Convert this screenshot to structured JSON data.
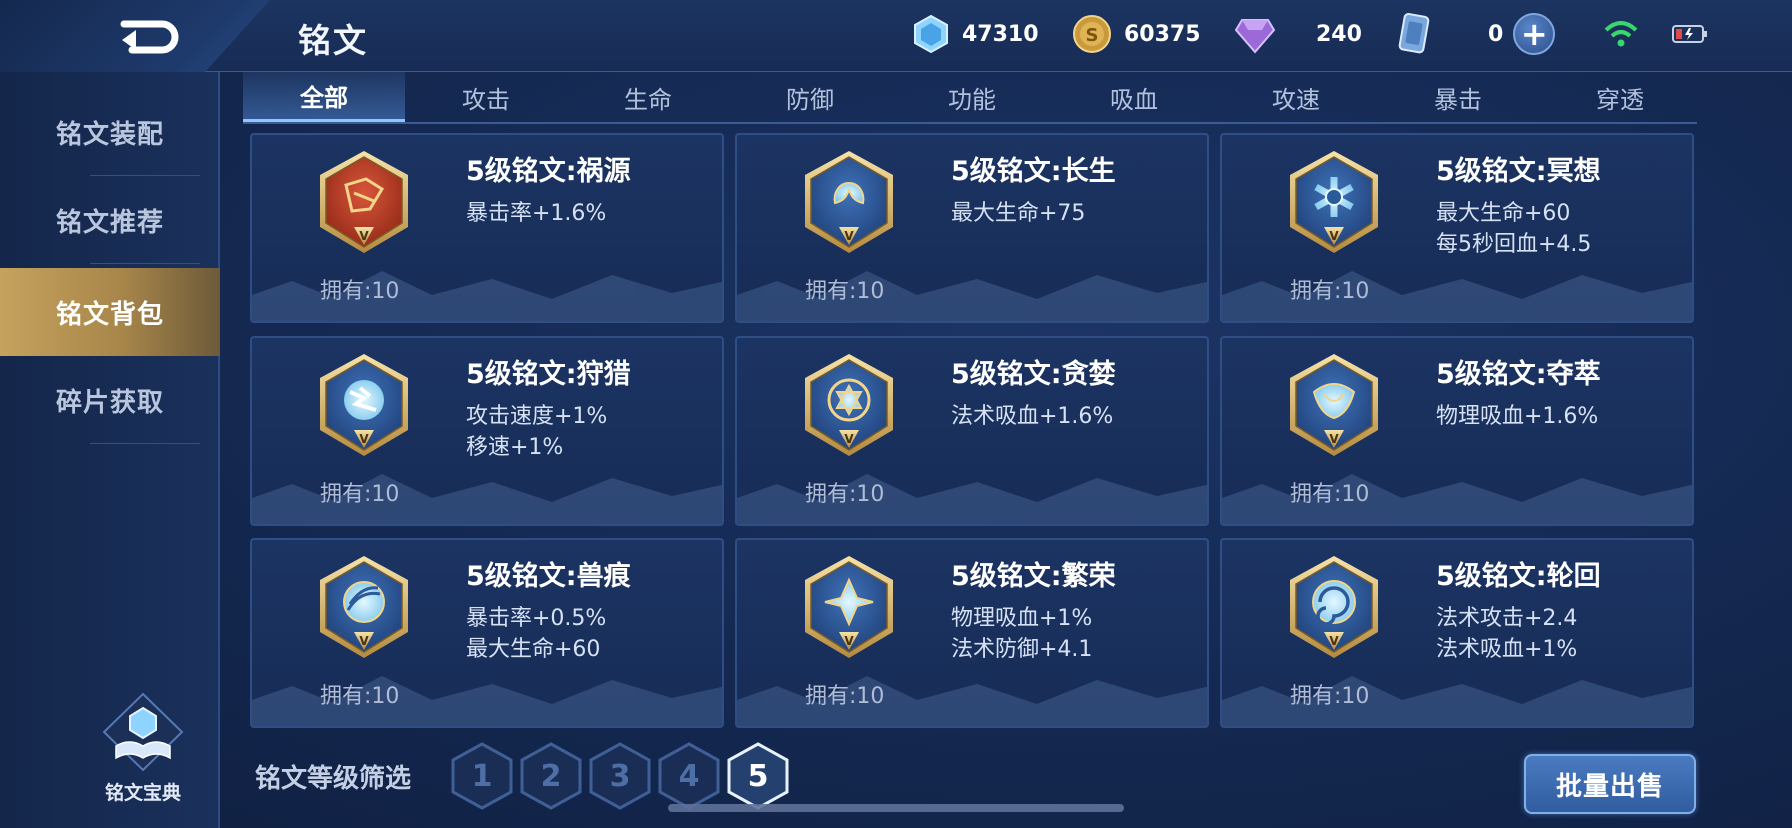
{
  "header": {
    "title": "铭文",
    "currencies": [
      {
        "name": "diamond-currency",
        "icon": "blue-crystal-icon",
        "value": "47310"
      },
      {
        "name": "gold-coin-currency",
        "icon": "gold-coin-icon",
        "value": "60375"
      },
      {
        "name": "gem-currency",
        "icon": "purple-gem-icon",
        "value": "240"
      },
      {
        "name": "card-currency",
        "icon": "card-icon",
        "value": "0"
      }
    ],
    "plus_label": "+"
  },
  "sidebar": {
    "items": [
      {
        "label": "铭文装配",
        "active": false
      },
      {
        "label": "铭文推荐",
        "active": false
      },
      {
        "label": "铭文背包",
        "active": true
      },
      {
        "label": "碎片获取",
        "active": false
      }
    ],
    "codex_label": "铭文宝典"
  },
  "tabs": [
    {
      "label": "全部",
      "active": true
    },
    {
      "label": "攻击",
      "active": false
    },
    {
      "label": "生命",
      "active": false
    },
    {
      "label": "防御",
      "active": false
    },
    {
      "label": "功能",
      "active": false
    },
    {
      "label": "吸血",
      "active": false
    },
    {
      "label": "攻速",
      "active": false
    },
    {
      "label": "暴击",
      "active": false
    },
    {
      "label": "穿透",
      "active": false
    }
  ],
  "cards": [
    {
      "name": "5级铭文:祸源",
      "stats": [
        "暴击率+1.6%"
      ],
      "owned": "拥有:10",
      "color": "red"
    },
    {
      "name": "5级铭文:长生",
      "stats": [
        "最大生命+75"
      ],
      "owned": "拥有:10",
      "color": "blue"
    },
    {
      "name": "5级铭文:冥想",
      "stats": [
        "最大生命+60",
        "每5秒回血+4.5"
      ],
      "owned": "拥有:10",
      "color": "blue"
    },
    {
      "name": "5级铭文:狩猎",
      "stats": [
        "攻击速度+1%",
        "移速+1%"
      ],
      "owned": "拥有:10",
      "color": "blue"
    },
    {
      "name": "5级铭文:贪婪",
      "stats": [
        "法术吸血+1.6%"
      ],
      "owned": "拥有:10",
      "color": "blue"
    },
    {
      "name": "5级铭文:夺萃",
      "stats": [
        "物理吸血+1.6%"
      ],
      "owned": "拥有:10",
      "color": "blue"
    },
    {
      "name": "5级铭文:兽痕",
      "stats": [
        "暴击率+0.5%",
        "最大生命+60"
      ],
      "owned": "拥有:10",
      "color": "blue"
    },
    {
      "name": "5级铭文:繁荣",
      "stats": [
        "物理吸血+1%",
        "法术防御+4.1"
      ],
      "owned": "拥有:10",
      "color": "blue"
    },
    {
      "name": "5级铭文:轮回",
      "stats": [
        "法术攻击+2.4",
        "法术吸血+1%"
      ],
      "owned": "拥有:10",
      "color": "blue"
    }
  ],
  "card_level_mark": "V",
  "filter": {
    "label": "铭文等级筛选",
    "levels": [
      "1",
      "2",
      "3",
      "4",
      "5"
    ],
    "selected": "5"
  },
  "sell_button": "批量出售",
  "colors": {
    "accent_gold": "#c5a25d",
    "tab_active": "#8fc6ff",
    "card_bg": "#1c3463",
    "rune_red": "#b6361f",
    "rune_blue": "#2e5a9c"
  }
}
